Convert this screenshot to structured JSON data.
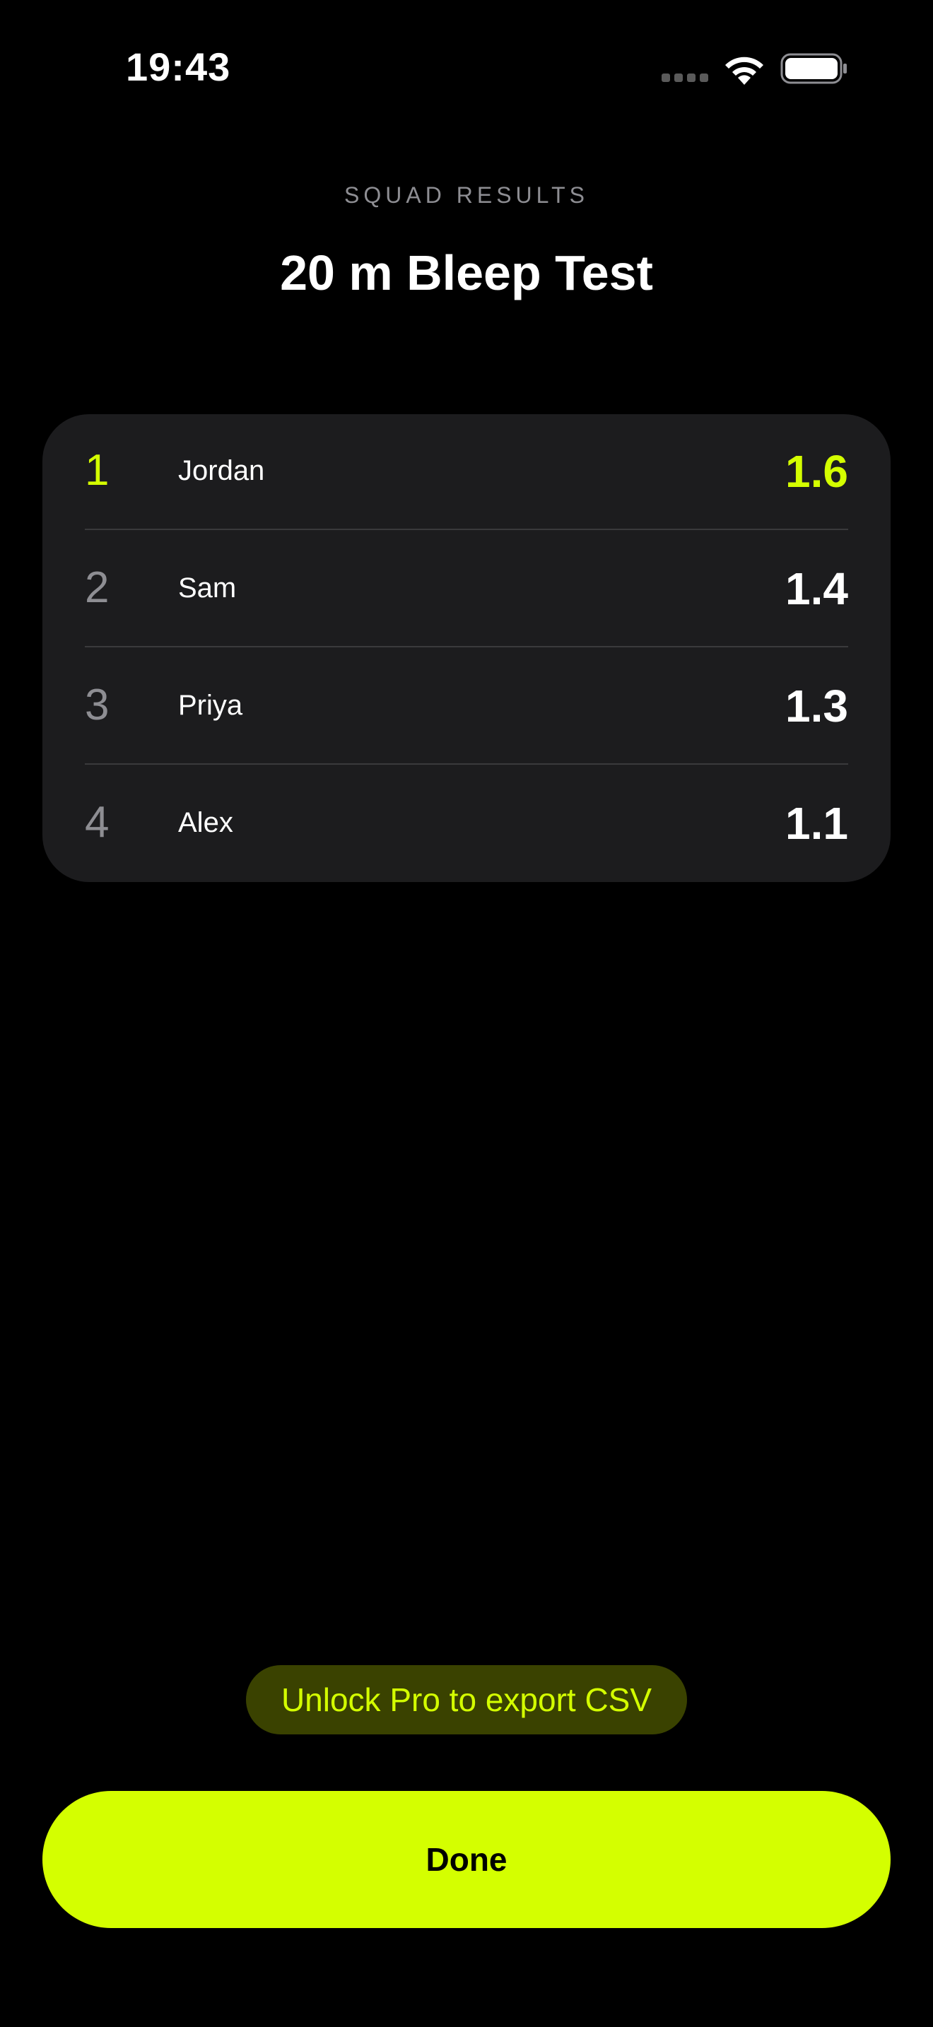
{
  "status_bar": {
    "time": "19:43"
  },
  "header": {
    "subtitle": "SQUAD RESULTS",
    "title": "20 m Bleep Test"
  },
  "results": [
    {
      "rank": "1",
      "name": "Jordan",
      "score": "1.6"
    },
    {
      "rank": "2",
      "name": "Sam",
      "score": "1.4"
    },
    {
      "rank": "3",
      "name": "Priya",
      "score": "1.3"
    },
    {
      "rank": "4",
      "name": "Alex",
      "score": "1.1"
    }
  ],
  "actions": {
    "pro_label": "Unlock Pro to export CSV",
    "done_label": "Done"
  },
  "colors": {
    "accent": "#d4ff00",
    "background": "#000000",
    "card": "#1c1c1e",
    "secondary_text": "#8e8e93",
    "pro_badge_bg": "#3a4200"
  },
  "icons": [
    "signal-icon",
    "wifi-icon",
    "battery-icon"
  ]
}
